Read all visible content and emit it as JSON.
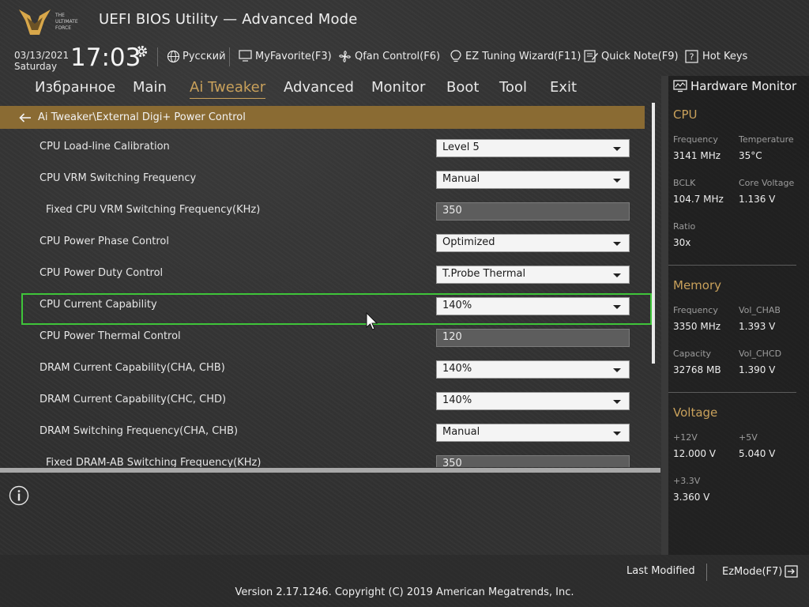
{
  "header": {
    "logo_text": "THE ULTIMATE FORCE",
    "title": "UEFI BIOS Utility — Advanced Mode",
    "date": "03/13/2021",
    "day": "Saturday",
    "time": "17:03"
  },
  "toolbar": {
    "language": "Русский",
    "myfavorite": "MyFavorite(F3)",
    "qfan": "Qfan Control(F6)",
    "ez_tuning": "EZ Tuning Wizard(F11)",
    "quick_note": "Quick Note(F9)",
    "hot_keys": "Hot Keys"
  },
  "tabs": [
    "Избранное",
    "Main",
    "Ai Tweaker",
    "Advanced",
    "Monitor",
    "Boot",
    "Tool",
    "Exit"
  ],
  "active_tab": "Ai Tweaker",
  "breadcrumb": "Ai Tweaker\\External Digi+ Power Control",
  "settings": [
    {
      "label": "CPU Load-line Calibration",
      "type": "dropdown",
      "value": "Level 5"
    },
    {
      "label": "CPU VRM Switching Frequency",
      "type": "dropdown",
      "value": "Manual"
    },
    {
      "label": "Fixed CPU VRM Switching Frequency(KHz)",
      "type": "field",
      "value": "350"
    },
    {
      "label": "CPU Power Phase Control",
      "type": "dropdown",
      "value": "Optimized"
    },
    {
      "label": "CPU Power Duty Control",
      "type": "dropdown",
      "value": "T.Probe Thermal"
    },
    {
      "label": "CPU Current Capability",
      "type": "dropdown",
      "value": "140%",
      "selected": true
    },
    {
      "label": "CPU Power Thermal Control",
      "type": "field",
      "value": "120"
    },
    {
      "label": "DRAM Current Capability(CHA, CHB)",
      "type": "dropdown",
      "value": "140%"
    },
    {
      "label": "DRAM Current Capability(CHC, CHD)",
      "type": "dropdown",
      "value": "140%"
    },
    {
      "label": "DRAM Switching Frequency(CHA, CHB)",
      "type": "dropdown",
      "value": "Manual"
    },
    {
      "label": "Fixed DRAM-AB Switching Frequency(KHz)",
      "type": "field",
      "value": "350"
    }
  ],
  "hardware_monitor": {
    "title": "Hardware Monitor",
    "cpu": {
      "section": "CPU",
      "frequency_label": "Frequency",
      "frequency": "3141 MHz",
      "temperature_label": "Temperature",
      "temperature": "35°C",
      "bclk_label": "BCLK",
      "bclk": "104.7 MHz",
      "core_voltage_label": "Core Voltage",
      "core_voltage": "1.136 V",
      "ratio_label": "Ratio",
      "ratio": "30x"
    },
    "memory": {
      "section": "Memory",
      "frequency_label": "Frequency",
      "frequency": "3350 MHz",
      "vol_chab_label": "Vol_CHAB",
      "vol_chab": "1.393 V",
      "capacity_label": "Capacity",
      "capacity": "32768 MB",
      "vol_chcd_label": "Vol_CHCD",
      "vol_chcd": "1.390 V"
    },
    "voltage": {
      "section": "Voltage",
      "v12_label": "+12V",
      "v12": "12.000 V",
      "v5_label": "+5V",
      "v5": "5.040 V",
      "v33_label": "+3.3V",
      "v33": "3.360 V"
    }
  },
  "footer": {
    "last_modified": "Last Modified",
    "ezmode": "EzMode(F7)",
    "copyright": "Version 2.17.1246. Copyright (C) 2019 American Megatrends, Inc."
  },
  "colors": {
    "accent_gold": "#c9a15b",
    "breadcrumb_bar": "#8a6b33",
    "selection_green": "#3fc43a"
  }
}
